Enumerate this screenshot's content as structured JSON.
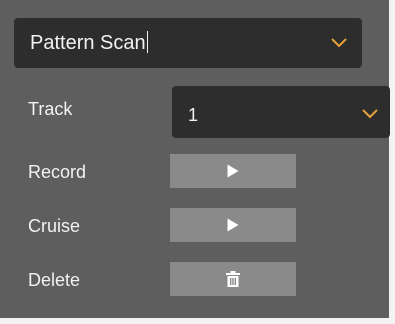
{
  "mode_select": {
    "value": "Pattern Scan",
    "icon": "chevron-down-icon",
    "accent_color": "#e8a13a"
  },
  "track": {
    "label": "Track",
    "value": "1",
    "icon": "chevron-down-icon"
  },
  "actions": [
    {
      "label": "Record",
      "icon": "play-icon"
    },
    {
      "label": "Cruise",
      "icon": "play-icon"
    },
    {
      "label": "Delete",
      "icon": "trash-icon"
    }
  ]
}
